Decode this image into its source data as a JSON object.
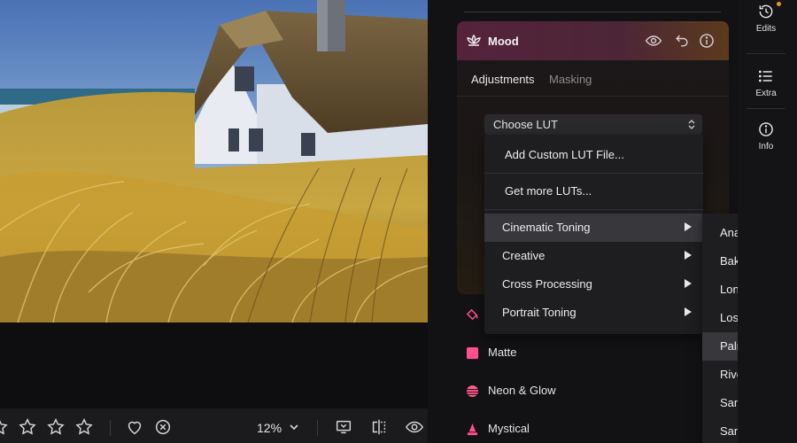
{
  "right_strip": {
    "items": [
      {
        "label": "Edits",
        "icon": "history-icon"
      },
      {
        "label": "Extra",
        "icon": "list-icon"
      },
      {
        "label": "Info",
        "icon": "info-icon"
      }
    ],
    "notification_color": "#e8912d"
  },
  "mood": {
    "title": "Mood",
    "tabs": {
      "active": "Adjustments",
      "inactive": "Masking"
    },
    "header_colors": {
      "left": "#55233a",
      "right": "#5b3a1c"
    }
  },
  "lut": {
    "select_label": "Choose LUT",
    "menu": {
      "actions": [
        "Add Custom LUT File...",
        "Get more LUTs..."
      ],
      "categories": [
        "Cinematic Toning",
        "Creative",
        "Cross Processing",
        "Portrait Toning"
      ],
      "highlighted": "Cinematic Toning"
    },
    "submenu": {
      "items": [
        "Anaheim",
        "Bakersfield",
        "Long Beach",
        "Los Angeles",
        "Palm Springs",
        "Riverside",
        "San Diego",
        "Santa Barbara"
      ],
      "hovered": "Palm Springs"
    }
  },
  "looks": [
    {
      "label": "Matte",
      "color": "#ff4f8f"
    },
    {
      "label": "Neon & Glow",
      "color": "#ff5a8c"
    },
    {
      "label": "Mystical",
      "color": "#ff4f8f"
    }
  ],
  "toolbar": {
    "stars_visible": 4,
    "zoom": "12%"
  }
}
